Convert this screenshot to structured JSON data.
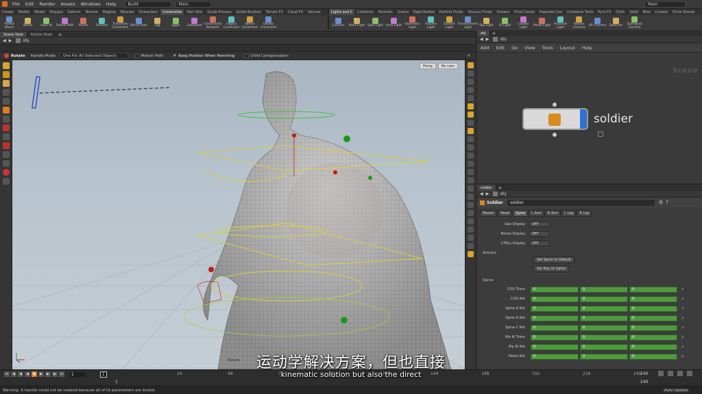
{
  "menubar": {
    "items": [
      "File",
      "Edit",
      "Render",
      "Assets",
      "Windows",
      "Help"
    ],
    "desktop": "Build",
    "right_desktop": "Main"
  },
  "shelf_left": {
    "tabs": [
      "Create",
      "Modify",
      "Model",
      "Polygon",
      "Deform",
      "Texture",
      "Rigging",
      "Muscles",
      "Characters",
      "Constraints",
      "Hair Utils",
      "Guide Process",
      "Guide Brushes",
      "Terrain FX",
      "Cloud FX",
      "Volume"
    ],
    "tools": [
      "Parent Blend",
      "Blend",
      "Look At",
      "Follow Path",
      "Points",
      "Surface",
      "Transform Constraint",
      "Blend Pose",
      "Lag",
      "Jiggle",
      "Gamepad",
      "Constraints Network",
      "Object Constraint",
      "Blend Constraint",
      "Delete Constraint"
    ]
  },
  "shelf_right": {
    "tabs": [
      "Lights and C",
      "Collisions",
      "Particles",
      "Grains",
      "Rigid Bodies",
      "Particle Fluids",
      "Viscous Fluids",
      "Oceans",
      "Fluid Contai",
      "Populate Con",
      "Container Tools",
      "Pyro FX",
      "Cloth",
      "Solid",
      "Wire",
      "Crowds",
      "Drive Simula"
    ],
    "tools": [
      "Camera",
      "Point Light",
      "Spot Light",
      "Area Light",
      "Geometry Light",
      "Volume Light",
      "Distant Light",
      "Environment Light",
      "Sky Light",
      "GI Light",
      "Caustic Light",
      "Portal Light",
      "Ambient Light",
      "Stereo Camera",
      "VR Camera",
      "Switcher",
      "Gamepad Camera"
    ]
  },
  "viewer": {
    "tabs": [
      "Scene View",
      "Python Shell"
    ],
    "path": "obj",
    "toolbar": {
      "tool": "Rotate",
      "handle_mode": "Handle Mode",
      "handle_option": "One For All Selected Objects",
      "motion_path": "Motion Path",
      "keep_position": "Keep Position When Parenting",
      "child_comp": "Child Compensation"
    },
    "persp": "Persp",
    "cam": "No cam",
    "corner_label": "Rotate"
  },
  "network": {
    "tab": "obj",
    "path": "obj",
    "menu": [
      "Add",
      "Edit",
      "Go",
      "View",
      "Tools",
      "Layout",
      "Help"
    ],
    "watermark": "Scene",
    "node_name": "soldier"
  },
  "params": {
    "tabs": [
      "soldier"
    ],
    "path": "obj",
    "type": "Soldier",
    "name": "soldier",
    "sections": [
      "Master",
      "Head",
      "Spine",
      "L Arm",
      "R Arm",
      "L Leg",
      "R Leg"
    ],
    "active_section": "Spine",
    "display": [
      {
        "label": "Geo Display",
        "value": "OFF"
      },
      {
        "label": "Bones Display",
        "value": "OFF"
      },
      {
        "label": "CTRLs Display",
        "value": "OFF"
      }
    ],
    "actions_label": "Actions",
    "action_buttons": [
      "Set Spine to Default",
      "Set Key on Spine"
    ],
    "spine_label": "Spine",
    "spine_rows": [
      {
        "label": "COG Trans",
        "values": [
          "0",
          "0",
          "0"
        ]
      },
      {
        "label": "COG Rot",
        "values": [
          "0",
          "0",
          "0"
        ]
      },
      {
        "label": "Spine A Rot",
        "values": [
          "0",
          "0",
          "0"
        ]
      },
      {
        "label": "Spine A Rot",
        "values": [
          "0",
          "0",
          "0"
        ]
      },
      {
        "label": "Spine C Rot",
        "values": [
          "0",
          "0",
          "0"
        ]
      },
      {
        "label": "Hip IK Trans",
        "values": [
          "0",
          "0",
          "0"
        ]
      },
      {
        "label": "Hip IK Rot",
        "values": [
          "0",
          "0",
          "0"
        ]
      },
      {
        "label": "Pelvis Rot",
        "values": [
          "0",
          "0",
          "0"
        ]
      }
    ]
  },
  "timeline": {
    "current_frame": "1",
    "start": "1",
    "end_a": "1",
    "frame_box": "1",
    "ticks": [
      "24",
      "48",
      "72",
      "96",
      "120",
      "144",
      "168",
      "192",
      "216",
      "240"
    ],
    "range_end_top": "240",
    "range_end_bottom": "240"
  },
  "status": {
    "message": "Warning:      A handle could not be created because all of its parameters are locked.",
    "auto_update": "Auto Update"
  },
  "subtitles": {
    "chinese": "运动学解决方案，但也直接",
    "english": "kinematic solution but also the direct"
  }
}
